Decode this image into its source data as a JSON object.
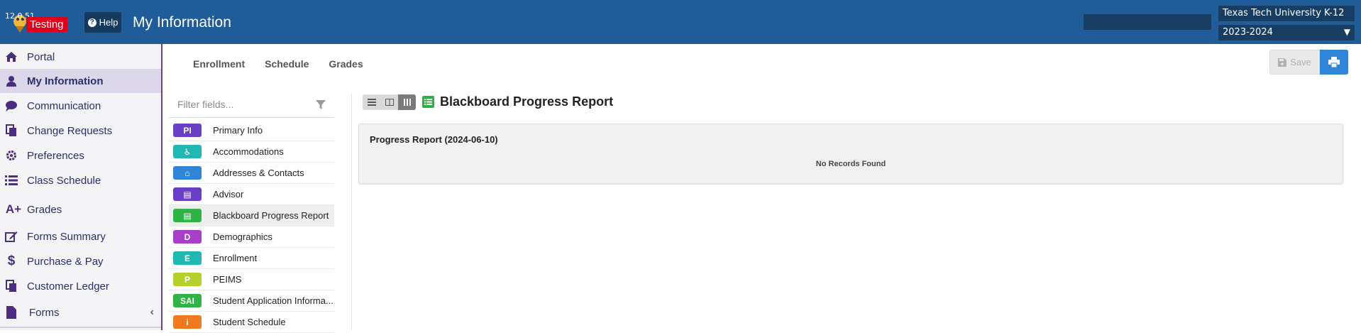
{
  "header": {
    "version": "12.0.51",
    "environment_badge": "Testing",
    "help_label": "Help",
    "page_title": "My Information",
    "org_select": "Texas Tech University K-12",
    "year_select": "2023-2024"
  },
  "sidebar": {
    "items": [
      {
        "label": "Portal",
        "icon": "home-icon"
      },
      {
        "label": "My Information",
        "icon": "user-icon",
        "active": true
      },
      {
        "label": "Communication",
        "icon": "chat-bubble-icon"
      },
      {
        "label": "Change Requests",
        "icon": "copy-document-icon"
      },
      {
        "label": "Preferences",
        "icon": "gear-icon"
      },
      {
        "label": "Class Schedule",
        "icon": "list-icon"
      },
      {
        "label": "Grades",
        "icon": "a-plus-icon"
      },
      {
        "label": "Forms Summary",
        "icon": "edit-form-icon"
      },
      {
        "label": "Purchase & Pay",
        "icon": "dollar-icon"
      },
      {
        "label": "Customer Ledger",
        "icon": "copy-document-icon"
      },
      {
        "label": "Forms",
        "icon": "file-icon"
      }
    ]
  },
  "tabs": [
    "Enrollment",
    "Schedule",
    "Grades"
  ],
  "actions": {
    "save_label": "Save"
  },
  "fields": {
    "filter_placeholder": "Filter fields...",
    "items": [
      {
        "badge": "PI",
        "label": "Primary Info",
        "color": "#6a3fc8"
      },
      {
        "badge": "♿",
        "label": "Accommodations",
        "color": "#20b8b0"
      },
      {
        "badge": "⌂",
        "label": "Addresses & Contacts",
        "color": "#2f86d6"
      },
      {
        "badge": "▤",
        "label": "Advisor",
        "color": "#6a3fc8"
      },
      {
        "badge": "▤",
        "label": "Blackboard Progress Report",
        "color": "#2fb344",
        "selected": true
      },
      {
        "badge": "D",
        "label": "Demographics",
        "color": "#a93fc8"
      },
      {
        "badge": "E",
        "label": "Enrollment",
        "color": "#20b8b0"
      },
      {
        "badge": "P",
        "label": "PEIMS",
        "color": "#b7cf2a"
      },
      {
        "badge": "SAI",
        "label": "Student Application Informa...",
        "color": "#2fb344"
      },
      {
        "badge": "i",
        "label": "Student Schedule",
        "color": "#f07a20"
      }
    ]
  },
  "main": {
    "section_title": "Blackboard Progress Report",
    "panel_title": "Progress Report (2024-06-10)",
    "empty_message": "No Records Found"
  }
}
